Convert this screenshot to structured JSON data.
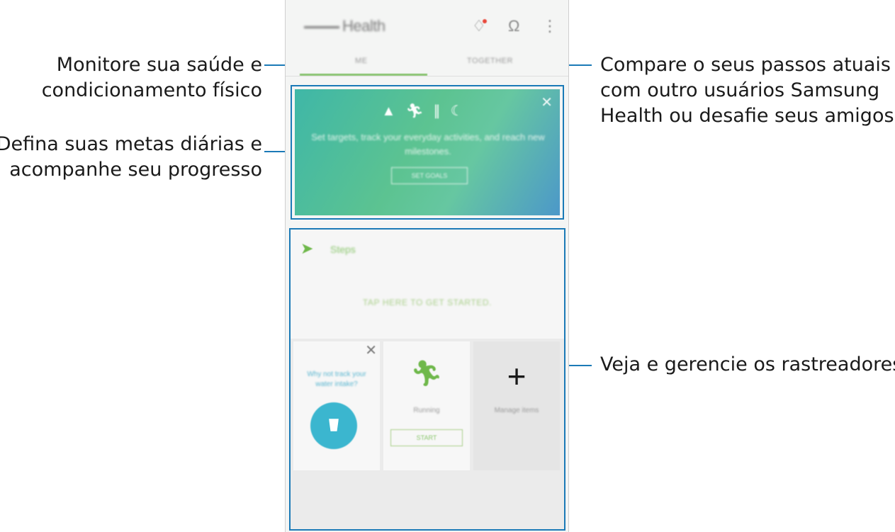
{
  "callouts": {
    "monitor": [
      "Monitore sua saúde e",
      "condicionamento físico"
    ],
    "goals": [
      "Defina suas metas diárias e",
      "acompanhe seu progresso"
    ],
    "compare": [
      "Compare o seus passos atuais",
      "com outro usuários Samsung",
      "Health ou desafie seus amigos"
    ],
    "trackers": [
      "Veja e gerencie os rastreadores"
    ]
  },
  "app": {
    "title": "Health",
    "tabs": [
      "ME",
      "TOGETHER"
    ],
    "active_tab": "ME"
  },
  "goals_banner": {
    "icons": [
      "walking-shoe-icon",
      "running-icon",
      "food-icon",
      "sleep-moon-icon"
    ],
    "text": "Set targets, track your everyday activities, and reach new milestones.",
    "button_label": "SET GOALS"
  },
  "steps": {
    "label": "Steps",
    "cta": "TAP HERE TO GET STARTED."
  },
  "tiles": {
    "water_prompt": "Why not track your water intake?",
    "running_label": "Running",
    "running_button": "START",
    "manage_label": "Manage items"
  },
  "colors": {
    "callout_line": "#1b7ab7",
    "accent_green": "#6fb84b",
    "water_blue": "#3bb6cf"
  }
}
